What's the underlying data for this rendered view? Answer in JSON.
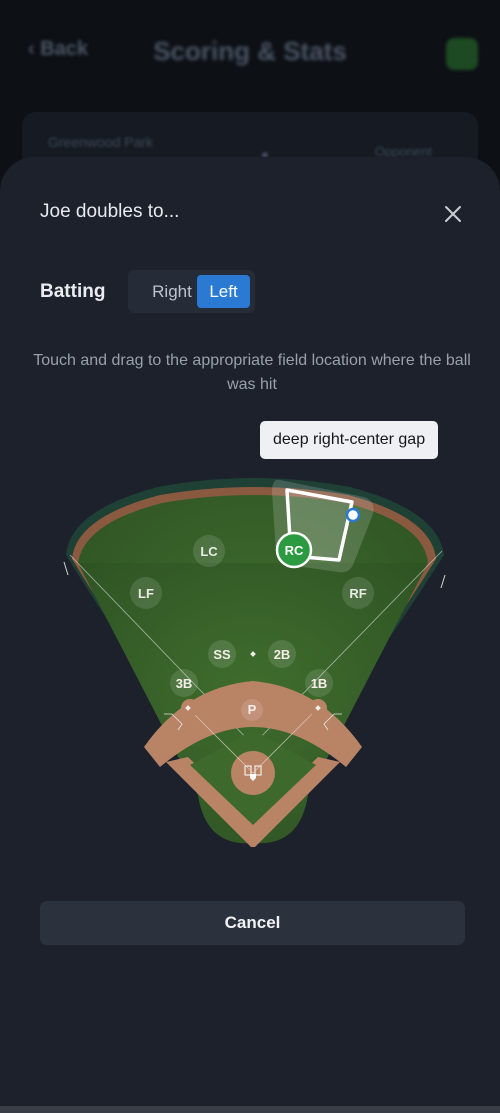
{
  "background": {
    "back_label": "‹ Back",
    "title": "Scoring & Stats",
    "card_left_label": "Greenwood Park",
    "card_right_label": "Opponent"
  },
  "modal": {
    "title": "Joe doubles to...",
    "batting_label": "Batting",
    "batting_options": [
      "Right",
      "Left"
    ],
    "batting_selected": "Left",
    "instruction": "Touch and drag to the appropriate field location where the ball was hit",
    "tooltip": "deep right-center gap",
    "cancel_label": "Cancel"
  },
  "field": {
    "positions": {
      "lf": "LF",
      "lc": "LC",
      "rc": "RC",
      "rf": "RF",
      "ss": "SS",
      "second_base": "2B",
      "third_base": "3B",
      "first_base": "1B",
      "pitcher": "P"
    },
    "selected_zone": "RC",
    "colors": {
      "grass": "#3f6a2e",
      "infield_dirt": "#b98466",
      "warning_track": "#8a5a40",
      "selected_marker": "#2b9a40",
      "accent": "#2a7ad4"
    }
  }
}
